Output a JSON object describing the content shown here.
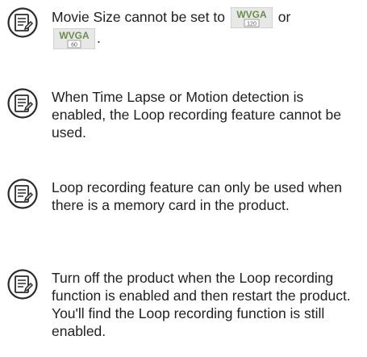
{
  "notes": [
    {
      "icon": "note-icon",
      "text_before": "Movie Size cannot be set to",
      "text_middle": "or",
      "text_after": ".",
      "badges": [
        {
          "icon": "movie-size-wvga-120-icon",
          "top": "WVGA",
          "bottom": "120"
        },
        {
          "icon": "movie-size-wvga-60-icon",
          "top": "WVGA",
          "bottom": "60"
        }
      ]
    },
    {
      "icon": "note-icon",
      "text": "When Time Lapse or Motion detection is enabled, the Loop recording feature cannot be used."
    },
    {
      "icon": "note-icon",
      "text": "Loop recording feature can only be used when there is a memory card in the product."
    },
    {
      "icon": "note-icon",
      "text": "Turn off the product when the Loop recording function is enabled and then restart the product. You'll find the Loop recording function is still enabled."
    }
  ]
}
